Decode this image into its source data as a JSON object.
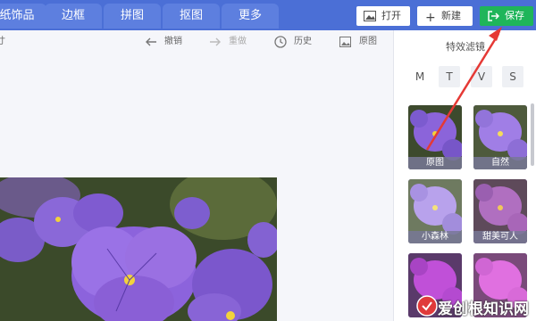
{
  "tabs": [
    "纸饰品",
    "边框",
    "拼图",
    "抠图",
    "更多"
  ],
  "top_buttons": {
    "open": "打开",
    "new": "新建",
    "save": "保存"
  },
  "toolbar": {
    "size": "寸",
    "undo": "撤销",
    "redo": "重做",
    "history": "历史",
    "original": "原图"
  },
  "panel": {
    "title": "特效滤镜",
    "mode_tabs": [
      "M",
      "T",
      "V",
      "S"
    ],
    "filters": [
      "原图",
      "自然",
      "小森林",
      "甜美可人",
      "",
      ""
    ]
  },
  "watermark": {
    "text": "爱创根知识网"
  },
  "colors": {
    "topbar": "#4b6fd6",
    "save": "#1fb55a",
    "arrow": "#e53935"
  }
}
